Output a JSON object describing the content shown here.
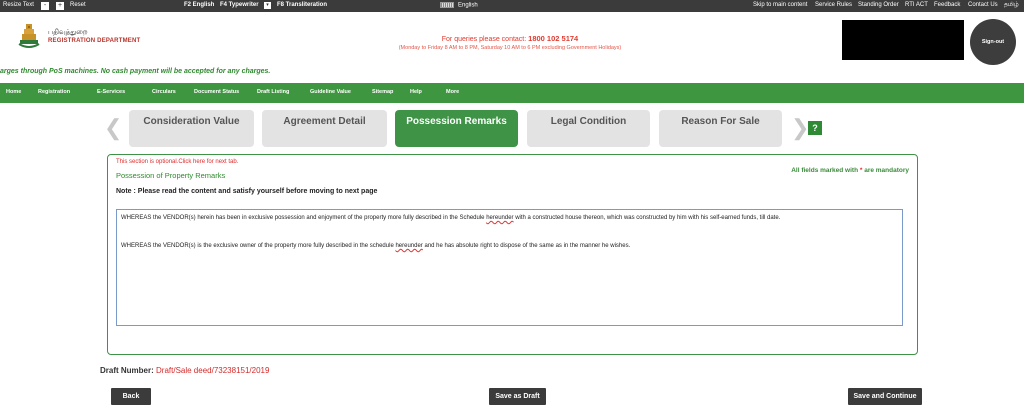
{
  "topbar": {
    "resize_text": "Resize Text",
    "minus": "-",
    "plus": "+",
    "reset": "Reset",
    "f2": "F2 English",
    "f4": "F4 Typewriter",
    "f4_key": "▾",
    "f8": "F8 Transliteration",
    "language": "English",
    "links": [
      "Skip to main content",
      "Service Rules",
      "Standing Order",
      "RTI ACT",
      "Feedback",
      "Contact Us",
      "தமிழ்"
    ]
  },
  "header": {
    "logo_tamil": "பதிவுத்துறை",
    "logo_english": "REGISTRATION DEPARTMENT",
    "contact_label": "For queries please contact:",
    "contact_number": "1800 102 5174",
    "contact_hours": "(Monday to Friday 8 AM to 8 PM, Saturday 10 AM to 6 PM excluding Government Holidays)",
    "signout": "Sign-out"
  },
  "marquee": "arges through PoS machines. No cash payment will be accepted for any charges.",
  "nav": [
    "Home",
    "Registration",
    "E-Services",
    "Circulars",
    "Document Status",
    "Draft Listing",
    "Guideline Value",
    "Sitemap",
    "Help",
    "More"
  ],
  "tabs": [
    "Consideration Value",
    "Agreement Detail",
    "Possession Remarks",
    "Legal Condition",
    "Reason For Sale"
  ],
  "active_tab": 2,
  "help_label": "?",
  "arrows": {
    "prev": "❮",
    "next": "❯"
  },
  "panel": {
    "optional_text": "This section is optional.Click here for next tab.",
    "title": "Possession of Property Remarks",
    "mandatory_prefix": "All fields marked with",
    "mandatory_star": "*",
    "mandatory_suffix": "are mandatory",
    "note": "Note : Please read the content and satisfy yourself before moving to next page",
    "remarks": [
      {
        "before": "WHEREAS the VENDOR(s) herein has been in exclusive possession and enjoyment of the property more fully described in the Schedule ",
        "spell": "hereunder",
        "after": " with a constructed house thereon, which was constructed by him with his self-earned funds, till date."
      },
      {
        "before": "WHEREAS the VENDOR(s) is the exclusive owner of the property more fully described in the schedule ",
        "spell": "hereunder",
        "after": " and he has absolute right to dispose of the same as in the manner he wishes."
      }
    ]
  },
  "draft": {
    "label": "Draft Number:",
    "value": "Draft/Sale deed/73238151/2019"
  },
  "buttons": {
    "back": "Back",
    "save_draft": "Save as Draft",
    "save_continue": "Save and Continue"
  },
  "colors": {
    "green": "#3f9640",
    "dark": "#3b3b3b",
    "red": "#e12b2b"
  }
}
